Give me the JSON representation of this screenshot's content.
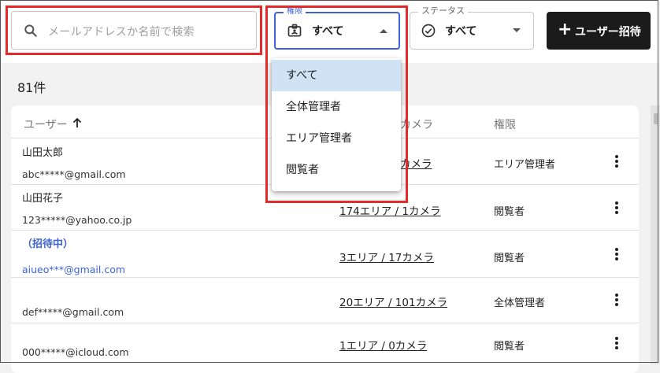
{
  "search": {
    "placeholder": "メールアドレスか名前で検索",
    "icon": "search-icon"
  },
  "filters": {
    "permission": {
      "label": "権限",
      "value": "すべて",
      "icon": "id-badge-icon"
    },
    "status": {
      "label": "ステータス",
      "value": "すべて",
      "icon": "check-circle-icon"
    }
  },
  "invite_button": {
    "label": "ユーザー招待",
    "icon": "plus-icon"
  },
  "result_count": "81件",
  "table": {
    "headers": {
      "user": "ユーザー",
      "area_camera": "カメラ",
      "permission": "権限"
    },
    "rows": [
      {
        "name": "山田太郎",
        "tag": "",
        "email": "abc*****@gmail.com",
        "area": "カメラ",
        "permission": "エリア管理者"
      },
      {
        "name": "山田花子",
        "tag": "",
        "email": "123*****@yahoo.co.jp",
        "area": "174エリア / 1カメラ",
        "permission": "閲覧者"
      },
      {
        "name": "",
        "tag": "（招待中）",
        "email": "aiueo***@gmail.com",
        "area": "3エリア / 17カメラ",
        "permission": "閲覧者"
      },
      {
        "name": "",
        "tag": "",
        "email": "def*****@gmail.com",
        "area": "20エリア / 101カメラ",
        "permission": "全体管理者"
      },
      {
        "name": "",
        "tag": "",
        "email": "000*****@icloud.com",
        "area": "1エリア / 0カメラ",
        "permission": "閲覧者"
      }
    ]
  },
  "permission_dropdown": {
    "options": [
      "すべて",
      "全体管理者",
      "エリア管理者",
      "閲覧者"
    ],
    "selected": "すべて"
  },
  "colors": {
    "accent": "#3d63d6",
    "highlight": "#e32b2b",
    "selected_option": "#cfe3f5",
    "primary_button": "#1b1b1b"
  }
}
